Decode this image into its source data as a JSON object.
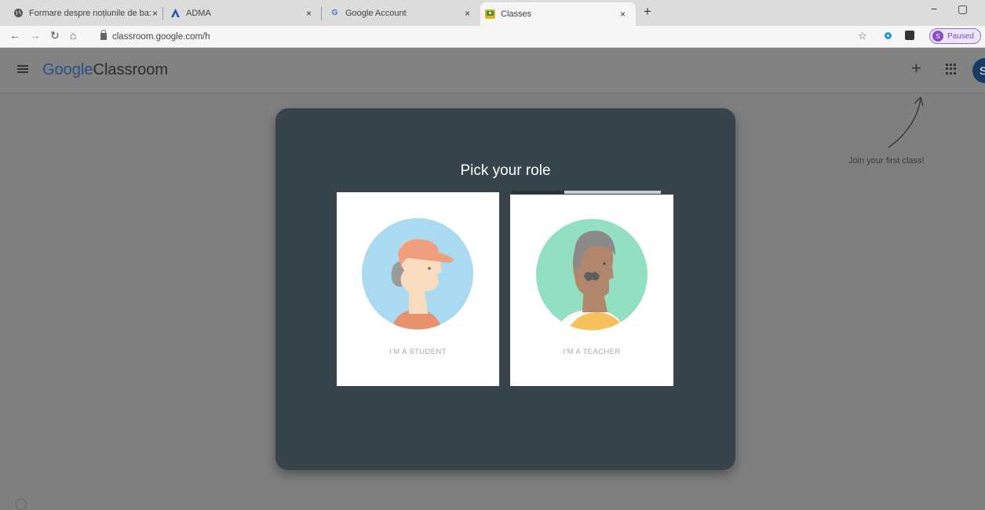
{
  "browser": {
    "tabs": [
      {
        "title": "Formare despre noțiunile de ba:",
        "icon": "globe-icon"
      },
      {
        "title": "ADMA",
        "icon": "adma-logo-icon"
      },
      {
        "title": "Google Account",
        "icon": "google-g-icon"
      },
      {
        "title": "Classes",
        "icon": "classroom-icon",
        "active": true
      }
    ],
    "close_glyph": "×",
    "new_tab_glyph": "+",
    "minimize_glyph": "−",
    "maximize_glyph": "▢",
    "url": "classroom.google.com/h",
    "profile": {
      "initial": "S",
      "label": "Paused"
    }
  },
  "app": {
    "brand": {
      "google": "Google",
      "classroom": "Classroom"
    },
    "add_glyph": "+",
    "avatar_initial": "S",
    "hint": "Join your first class!"
  },
  "dialog": {
    "title": "Pick your role",
    "options": [
      {
        "label": "I'M A STUDENT"
      },
      {
        "label": "I'M A TEACHER"
      }
    ]
  },
  "colors": {
    "dialog_bg": "#37444c",
    "student_circle": "#a9daf2",
    "teacher_circle": "#92dfc1"
  }
}
